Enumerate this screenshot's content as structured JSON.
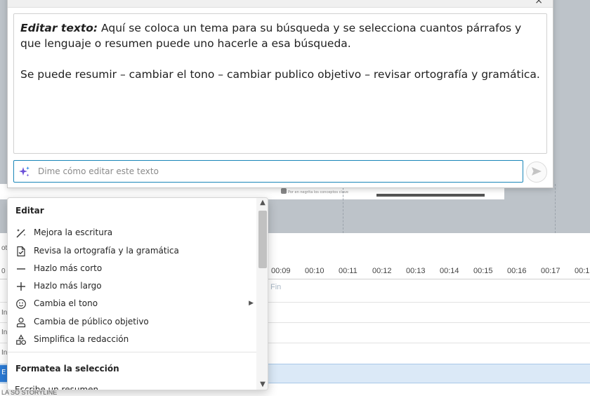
{
  "dialog": {
    "body_lead": "Editar texto:",
    "body_line1": " Aquí se coloca un tema para su búsqueda y se selecciona cuantos párrafos y que lenguaje o resumen puede uno hacerle a esa búsqueda.",
    "body_line2": "Se puede resumir – cambiar el tono – cambiar publico objetivo – revisar ortografía y gramática.",
    "prompt_placeholder": "Dime cómo editar este texto",
    "close_glyph": "×"
  },
  "menu": {
    "section1_title": "Editar",
    "items": [
      {
        "label": "Mejora la escritura",
        "icon": "magic-wand-icon"
      },
      {
        "label": "Revisa la ortografía y la gramática",
        "icon": "document-check-icon"
      },
      {
        "label": "Hazlo más corto",
        "icon": "minus-icon"
      },
      {
        "label": "Hazlo más largo",
        "icon": "plus-icon"
      },
      {
        "label": "Cambia el tono",
        "icon": "smiley-icon",
        "submenu": true
      },
      {
        "label": "Cambia de público objetivo",
        "icon": "person-icon"
      },
      {
        "label": "Simplifica la redacción",
        "icon": "shapes-icon"
      }
    ],
    "section2_title": "Formatea la selección",
    "partial_item": "Escribe un resumen"
  },
  "timeline": {
    "ticks": [
      "00:09",
      "00:10",
      "00:11",
      "00:12",
      "00:13",
      "00:14",
      "00:15",
      "00:16",
      "00:17",
      "00:1"
    ],
    "end_label": "Fin",
    "left_labels": [
      "ot",
      "0",
      "In",
      "In",
      "In",
      "E"
    ],
    "bottom_label": "LA SO STORYLINE"
  },
  "slide": {
    "caption": "Por en negrita los conceptos clave"
  },
  "colors": {
    "accent": "#1a86b8",
    "sparkle": "#6b4fd8",
    "selection": "#dbe9f7"
  }
}
